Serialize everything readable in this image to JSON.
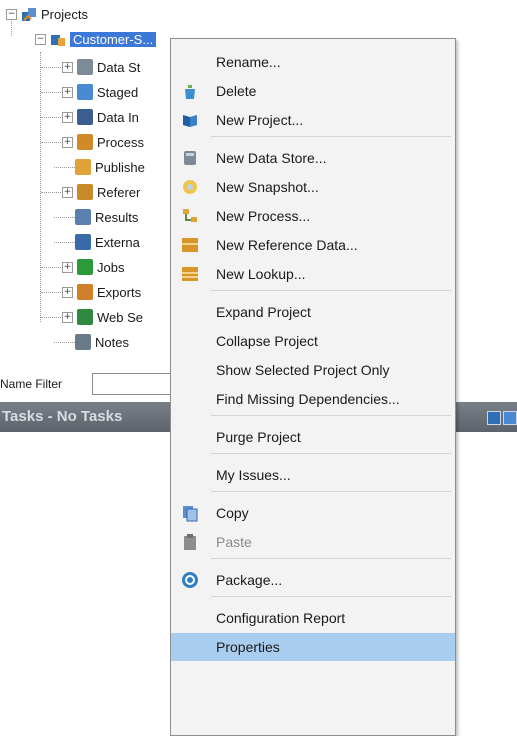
{
  "tree": {
    "root": "Projects",
    "project": "Customer-S...",
    "children": [
      "Data St",
      "Staged",
      "Data In",
      "Process",
      "Publishe",
      "Referer",
      "Results",
      "Externa",
      "Jobs",
      "Exports",
      "Web Se",
      "Notes"
    ]
  },
  "filter": {
    "label": "Name Filter",
    "value": ""
  },
  "tasks": {
    "title": "Tasks - No Tasks"
  },
  "menu": {
    "items": [
      {
        "label": "Rename...",
        "icon": "none"
      },
      {
        "label": "Delete",
        "icon": "recycle-icon"
      },
      {
        "label": "New Project...",
        "icon": "project-icon"
      },
      {
        "label": "New Data Store...",
        "icon": "data-store-icon"
      },
      {
        "label": "New Snapshot...",
        "icon": "snapshot-icon"
      },
      {
        "label": "New Process...",
        "icon": "process-icon"
      },
      {
        "label": "New Reference Data...",
        "icon": "reference-data-icon"
      },
      {
        "label": "New Lookup...",
        "icon": "lookup-icon"
      },
      {
        "label": "Expand Project",
        "icon": "none"
      },
      {
        "label": "Collapse Project",
        "icon": "none"
      },
      {
        "label": "Show Selected Project Only",
        "icon": "none"
      },
      {
        "label": "Find Missing Dependencies...",
        "icon": "none"
      },
      {
        "label": "Purge Project",
        "icon": "none"
      },
      {
        "label": "My Issues...",
        "icon": "none"
      },
      {
        "label": "Copy",
        "icon": "copy-icon"
      },
      {
        "label": "Paste",
        "icon": "paste-icon",
        "disabled": true
      },
      {
        "label": "Package...",
        "icon": "package-icon"
      },
      {
        "label": "Configuration Report",
        "icon": "none"
      },
      {
        "label": "Properties",
        "icon": "none",
        "highlighted": true
      }
    ]
  },
  "colors": {
    "selection": "#3b78d8",
    "menu_highlight": "#a9cdef",
    "tasks_bar": "#5d636b"
  }
}
